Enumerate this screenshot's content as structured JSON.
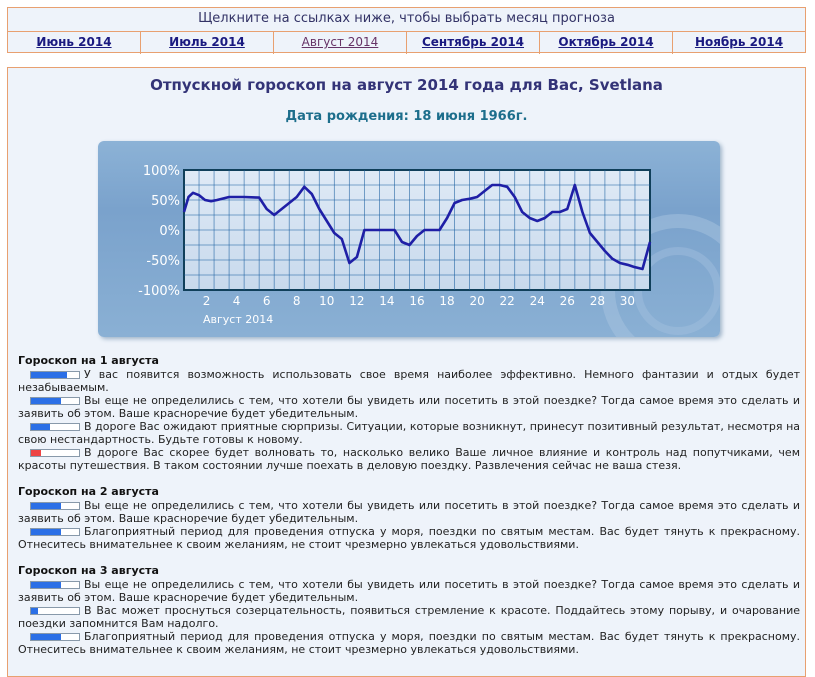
{
  "nav": {
    "header": "Щелкните на ссылках ниже, чтобы выбрать месяц прогноза",
    "months": [
      {
        "label": "Июнь 2014",
        "active": false
      },
      {
        "label": "Июль 2014",
        "active": false
      },
      {
        "label": "Август 2014",
        "active": true
      },
      {
        "label": "Сентябрь 2014",
        "active": false
      },
      {
        "label": "Октябрь 2014",
        "active": false
      },
      {
        "label": "Ноябрь 2014",
        "active": false
      }
    ]
  },
  "main": {
    "title": "Отпускной гороскоп на август 2014 года для Вас, Svetlana",
    "birth": "Дата рождения: 18 июня 1966г."
  },
  "chart_data": {
    "type": "line",
    "xlabel": "Август 2014",
    "ylabel": "",
    "title": "",
    "xlim": [
      0,
      31
    ],
    "ylim": [
      -100,
      100
    ],
    "x_ticks": [
      2,
      4,
      6,
      8,
      10,
      12,
      14,
      16,
      18,
      20,
      22,
      24,
      26,
      28,
      30
    ],
    "y_ticks": [
      "100%",
      "50%",
      "0%",
      "-50%",
      "-100%"
    ],
    "grid": true,
    "line_color": "#1f1fa6",
    "x": [
      0.0,
      0.3,
      0.6,
      1.0,
      1.4,
      1.8,
      2.2,
      3.0,
      4.0,
      5.0,
      5.5,
      6.0,
      6.5,
      7.0,
      7.5,
      8.0,
      8.5,
      9.0,
      9.5,
      10.0,
      10.5,
      11.0,
      11.5,
      12.0,
      13.0,
      14.0,
      14.5,
      15.0,
      15.5,
      16.0,
      16.5,
      17.0,
      17.5,
      18.0,
      18.5,
      19.0,
      19.5,
      20.0,
      20.5,
      21.0,
      21.5,
      22.0,
      22.5,
      23.0,
      23.5,
      24.0,
      24.5,
      25.0,
      25.5,
      26.0,
      26.5,
      27.0,
      27.5,
      28.0,
      28.5,
      29.0,
      29.5,
      30.0,
      30.5,
      31.0
    ],
    "y": [
      30,
      55,
      62,
      58,
      50,
      48,
      50,
      55,
      55,
      54,
      35,
      25,
      35,
      45,
      55,
      72,
      60,
      35,
      15,
      -5,
      -15,
      -55,
      -45,
      0,
      0,
      0,
      -20,
      -25,
      -10,
      0,
      0,
      0,
      20,
      45,
      50,
      52,
      55,
      65,
      75,
      75,
      72,
      55,
      30,
      20,
      15,
      20,
      30,
      30,
      35,
      75,
      30,
      -5,
      -20,
      -35,
      -48,
      -55,
      -58,
      -62,
      -65,
      -20
    ]
  },
  "sections": [
    {
      "heading": "Гороскоп на 1 августа",
      "items": [
        {
          "text": "У вас появится возможность использовать свое время наиболее эффективно. Немного фантазии и отдых будет незабываемым.",
          "level": 0.75,
          "tone": "pos"
        },
        {
          "text": "Вы еще не определились с тем, что хотели бы увидеть или посетить в этой поездке? Тогда самое время это сделать и заявить об этом. Ваше красноречие будет убедительным.",
          "level": 0.62,
          "tone": "pos"
        },
        {
          "text": "В дороге Вас ожидают приятные сюрпризы. Ситуации, которые возникнут, принесут позитивный результат, несмотря на свою нестандартность. Будьте готовы к новому.",
          "level": 0.4,
          "tone": "pos"
        },
        {
          "text": "В дороге Вас скорее будет волновать то, насколько велико Ваше личное влияние и контроль над попутчиками, чем красоты путешествия. В таком состоянии лучше поехать в деловую поездку. Развлечения сейчас не ваша стезя.",
          "level": 0.2,
          "tone": "neg"
        }
      ]
    },
    {
      "heading": "Гороскоп на 2 августа",
      "items": [
        {
          "text": "Вы еще не определились с тем, что хотели бы увидеть или посетить в этой поездке? Тогда самое время это сделать и заявить об этом. Ваше красноречие будет убедительным.",
          "level": 0.62,
          "tone": "pos"
        },
        {
          "text": "Благоприятный период для проведения отпуска у моря, поездки по святым местам. Вас будет тянуть к прекрасному. Отнеситесь внимательнее к своим желаниям, не стоит чрезмерно увлекаться удовольствиями.",
          "level": 0.62,
          "tone": "pos"
        }
      ]
    },
    {
      "heading": "Гороскоп на 3 августа",
      "items": [
        {
          "text": "Вы еще не определились с тем, что хотели бы увидеть или посетить в этой поездке? Тогда самое время это сделать и заявить об этом. Ваше красноречие будет убедительным.",
          "level": 0.62,
          "tone": "pos"
        },
        {
          "text": "В Вас может проснуться созерцательность, появиться стремление к красоте. Поддайтесь этому порыву, и очарование поездки запомнится Вам надолго.",
          "level": 0.15,
          "tone": "pos"
        },
        {
          "text": "Благоприятный период для проведения отпуска у моря, поездки по святым местам. Вас будет тянуть к прекрасному. Отнеситесь внимательнее к своим желаниям, не стоит чрезмерно увлекаться удовольствиями.",
          "level": 0.62,
          "tone": "pos"
        }
      ]
    }
  ]
}
